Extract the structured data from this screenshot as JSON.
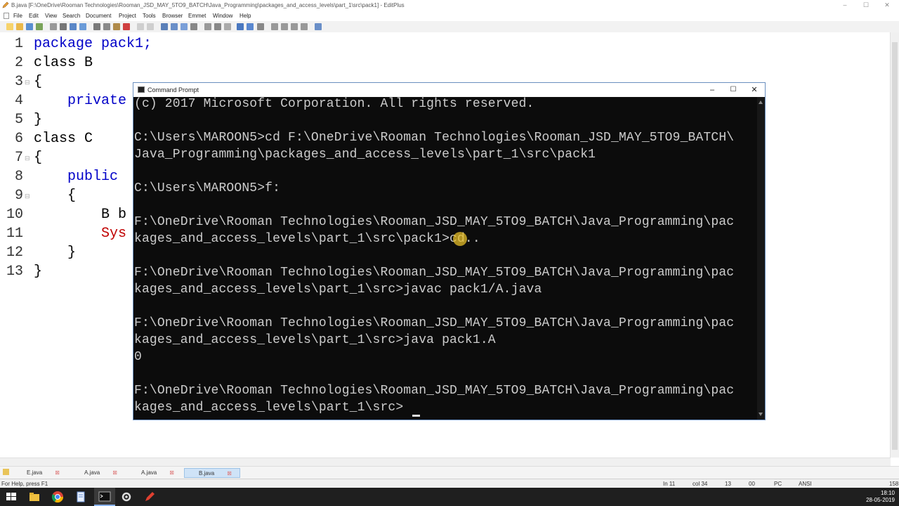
{
  "window": {
    "title": "B.java [F:\\OneDrive\\Rooman Technologies\\Rooman_JSD_MAY_5TO9_BATCH\\Java_Programming\\packages_and_access_levels\\part_1\\src\\pack1] - EditPlus"
  },
  "menu": [
    "File",
    "Edit",
    "View",
    "Search",
    "Document",
    "Project",
    "Tools",
    "Browser",
    "Emmet",
    "Window",
    "Help"
  ],
  "editor": {
    "lines": [
      {
        "n": "1",
        "code": "package pack1;"
      },
      {
        "n": "2",
        "code": "class B"
      },
      {
        "n": "3",
        "code": "{"
      },
      {
        "n": "4",
        "code": "    private"
      },
      {
        "n": "5",
        "code": "}"
      },
      {
        "n": "6",
        "code": "class C"
      },
      {
        "n": "7",
        "code": "{"
      },
      {
        "n": "8",
        "code": "    public"
      },
      {
        "n": "9",
        "code": "    {"
      },
      {
        "n": "10",
        "code": "        B b"
      },
      {
        "n": "11",
        "code": "        Sys"
      },
      {
        "n": "12",
        "code": "    }"
      },
      {
        "n": "13",
        "code": "}"
      }
    ]
  },
  "tabs": [
    {
      "label": "E.java",
      "active": false
    },
    {
      "label": "A.java",
      "active": false
    },
    {
      "label": "A.java",
      "active": false
    },
    {
      "label": "B.java",
      "active": true
    }
  ],
  "status": {
    "help": "For Help, press F1",
    "line": "In 11",
    "col": "col 34",
    "num": "13",
    "hex": "00",
    "eol": "PC",
    "encoding": "ANSI",
    "extra": "158"
  },
  "clock": {
    "time": "18:10",
    "date": "28-05-2019"
  },
  "cmd": {
    "title": "Command Prompt",
    "lines": [
      "(c) 2017 Microsoft Corporation. All rights reserved.",
      "",
      "C:\\Users\\MAROON5>cd F:\\OneDrive\\Rooman Technologies\\Rooman_JSD_MAY_5TO9_BATCH\\",
      "Java_Programming\\packages_and_access_levels\\part_1\\src\\pack1",
      "",
      "C:\\Users\\MAROON5>f:",
      "",
      "F:\\OneDrive\\Rooman Technologies\\Rooman_JSD_MAY_5TO9_BATCH\\Java_Programming\\pac",
      "kages_and_access_levels\\part_1\\src\\pack1>cd..",
      "",
      "F:\\OneDrive\\Rooman Technologies\\Rooman_JSD_MAY_5TO9_BATCH\\Java_Programming\\pac",
      "kages_and_access_levels\\part_1\\src>javac pack1/A.java",
      "",
      "F:\\OneDrive\\Rooman Technologies\\Rooman_JSD_MAY_5TO9_BATCH\\Java_Programming\\pac",
      "kages_and_access_levels\\part_1\\src>java pack1.A",
      "0",
      "",
      "F:\\OneDrive\\Rooman Technologies\\Rooman_JSD_MAY_5TO9_BATCH\\Java_Programming\\pac",
      "kages_and_access_levels\\part_1\\src>"
    ]
  },
  "colors": {
    "keyword": "#0000c8",
    "console_bg": "#0c0c0c",
    "console_fg": "#cccccc"
  }
}
